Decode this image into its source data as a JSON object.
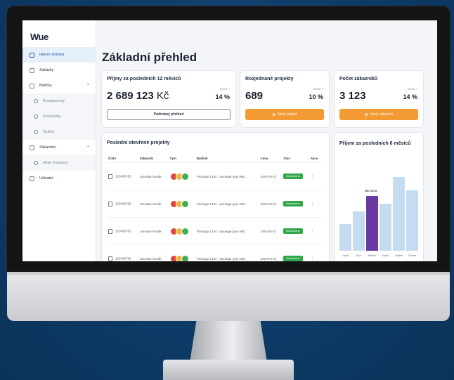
{
  "app": {
    "logo": "Wue"
  },
  "sidebar": {
    "items": [
      {
        "label": "Hlavní stránka",
        "icon": "home-icon",
        "active": true
      },
      {
        "label": "Zakázky",
        "icon": "orders-icon"
      },
      {
        "label": "Balíčky",
        "icon": "package-icon",
        "expanded": true
      },
      {
        "label": "Komponenty",
        "icon": "component-icon",
        "sub": true
      },
      {
        "label": "Součástky",
        "icon": "part-icon",
        "sub": true
      },
      {
        "label": "Služby",
        "icon": "service-icon",
        "sub": true
      },
      {
        "label": "Zákazníci",
        "icon": "customers-icon",
        "expanded": true
      },
      {
        "label": "Moje Instalace",
        "icon": "install-icon",
        "sub": true
      },
      {
        "label": "Uživatel",
        "icon": "user-icon"
      }
    ]
  },
  "page": {
    "title": "Základní přehled"
  },
  "cards": {
    "revenue": {
      "title": "Příjmy za posledních 12 měsíců",
      "value": "2 689 123",
      "unit": "Kč",
      "trend_label": "Nárůst",
      "trend_arrow": "↗",
      "pct": "14 %",
      "button": "Podrobný přehled"
    },
    "projects": {
      "title": "Rozjednané projekty",
      "value": "689",
      "trend_label": "Nárůst",
      "trend_arrow": "↗",
      "pct": "10 %",
      "button": "Nový projekt",
      "button_icon": "⊕"
    },
    "customers": {
      "title": "Počet zákazníků",
      "value": "3 123",
      "trend_label": "Nárůst",
      "trend_arrow": "↗",
      "pct": "14 %",
      "button": "Nový zákazník",
      "button_icon": "⊕"
    }
  },
  "table": {
    "title": "Poslední otevřené projekty",
    "headers": [
      "Číslo",
      "Zákazník",
      "Tým",
      "Balíček",
      "Cena",
      "Stav",
      "Akce"
    ],
    "rows": [
      {
        "number": "123456765",
        "customer": "Jaroslav Novák",
        "package": "Package 1234 - package type ABC",
        "price": "345 678 Kč",
        "status": "Dokončeno"
      },
      {
        "number": "123456765",
        "customer": "Jaroslav Novák",
        "package": "Package 1234 - package type ABC",
        "price": "345 678 Kč",
        "status": "Dokončeno"
      },
      {
        "number": "123456765",
        "customer": "Jaroslav Novák",
        "package": "Package 1234 - package type ABC",
        "price": "345 678 Kč",
        "status": "Dokončeno"
      },
      {
        "number": "123456765",
        "customer": "Jaroslav Novák",
        "package": "Package 1234 - package type ABC",
        "price": "345 678 Kč",
        "status": "Dokončeno"
      }
    ],
    "action_glyph": "⋮"
  },
  "colors": {
    "accent": "#f39a32",
    "status_done": "#2ea84a",
    "highlight_bar": "#6b3aa0",
    "bar": "#c5dbf2",
    "active_nav": "#1f5fa8"
  },
  "chart_data": {
    "type": "bar",
    "title": "Příjem za posledních 6 měsíců",
    "categories": [
      "Leden",
      "Únor",
      "Březen",
      "Duben",
      "Květen",
      "Červen"
    ],
    "values": [
      170000,
      250000,
      350123,
      300000,
      470000,
      385000
    ],
    "highlight_index": 2,
    "highlight_label": "350 123 Kč",
    "xlabel": "",
    "ylabel": "",
    "ylim": [
      0,
      500000
    ],
    "grid": false
  }
}
